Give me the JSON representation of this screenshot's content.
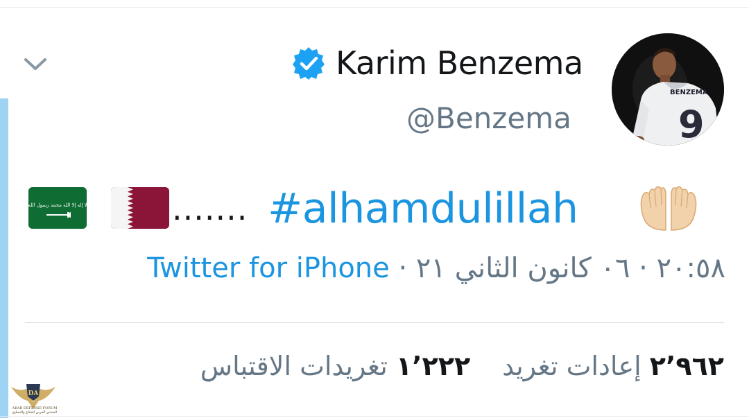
{
  "tweet": {
    "author": {
      "display_name": "Karim Benzema",
      "handle": "@Benzema",
      "verified": true,
      "avatar_jersey_text": "BENZEMA",
      "avatar_jersey_number": "9"
    },
    "text": {
      "flags": [
        "saudi-arabia-flag",
        "qatar-flag"
      ],
      "flag_saudi_inscription": "لا إله إلا الله محمد رسول الله",
      "ellipsis": ".......",
      "hashtag": "#alhamdulillah",
      "emoji": "folded-hands"
    },
    "meta": {
      "time": "٢٠:٥٨",
      "separator": "·",
      "date": "٠٦ كانون الثاني ٢١",
      "source": "Twitter for iPhone"
    },
    "stats": {
      "retweets_count": "٢٬٩٦٢",
      "retweets_label": "إعادات تغريد",
      "quotes_count": "١٬٢٢٢",
      "quotes_label": "تغريدات الاقتباس"
    }
  },
  "watermark": {
    "logo_letters": "DA",
    "line1": "ARAB DEFENSE FORUM",
    "line2": "المنتدى العربي للدفاع والتسليح"
  },
  "colors": {
    "link": "#1b95e0",
    "text_primary": "#14171a",
    "text_secondary": "#657786",
    "thread_line": "#9fd3f3",
    "verified": "#1da1f2"
  }
}
